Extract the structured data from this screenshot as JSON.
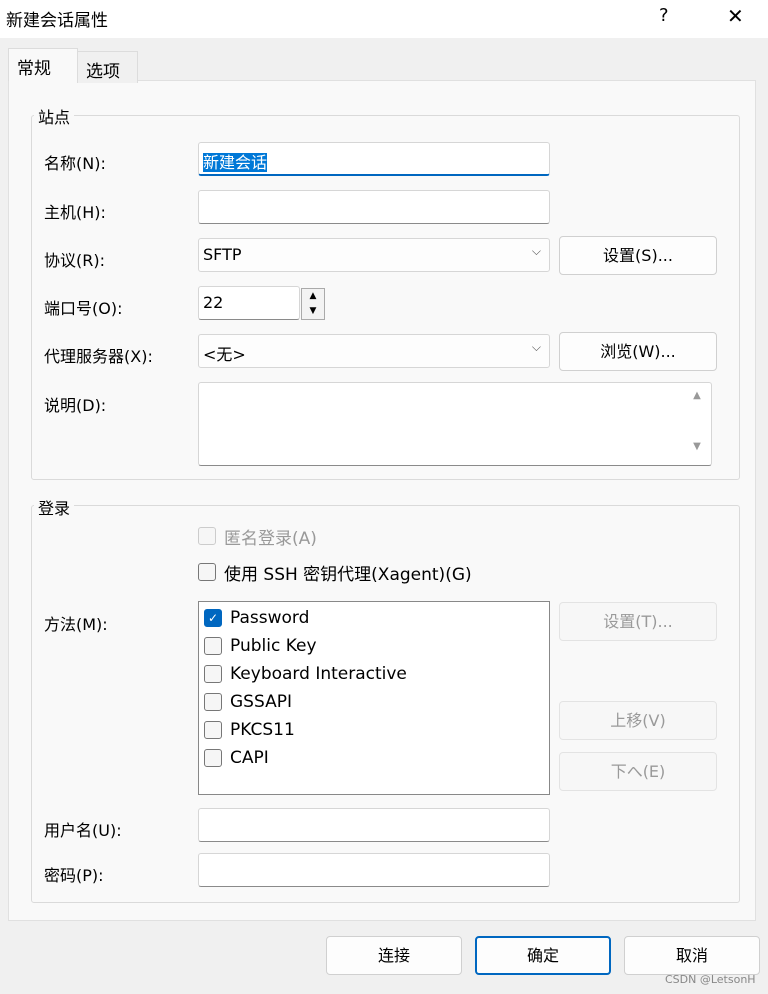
{
  "window": {
    "title": "新建会话属性",
    "help": "?",
    "close": "✕"
  },
  "tabs": [
    {
      "label": "常规",
      "active": true
    },
    {
      "label": "选项",
      "active": false
    }
  ],
  "site": {
    "legend": "站点",
    "name_label": "名称(N):",
    "name_value": "新建会话",
    "host_label": "主机(H):",
    "host_value": "",
    "protocol_label": "协议(R):",
    "protocol_value": "SFTP",
    "protocol_settings": "设置(S)...",
    "port_label": "端口号(O):",
    "port_value": "22",
    "proxy_label": "代理服务器(X):",
    "proxy_value": "<无>",
    "proxy_browse": "浏览(W)...",
    "desc_label": "说明(D):",
    "desc_value": ""
  },
  "login": {
    "legend": "登录",
    "anonymous": {
      "label": "匿名登录(A)",
      "checked": false,
      "disabled": true
    },
    "xagent": {
      "label": "使用 SSH 密钥代理(Xagent)(G)",
      "checked": false
    },
    "method_label": "方法(M):",
    "methods": [
      {
        "label": "Password",
        "checked": true
      },
      {
        "label": "Public Key",
        "checked": false
      },
      {
        "label": "Keyboard Interactive",
        "checked": false
      },
      {
        "label": "GSSAPI",
        "checked": false
      },
      {
        "label": "PKCS11",
        "checked": false
      },
      {
        "label": "CAPI",
        "checked": false
      }
    ],
    "settings": "设置(T)...",
    "up": "上移(V)",
    "down": "下へ(E)",
    "user_label": "用户名(U):",
    "user_value": "",
    "pass_label": "密码(P):",
    "pass_value": ""
  },
  "buttons": {
    "connect": "连接",
    "ok": "确定",
    "cancel": "取消"
  },
  "watermark": "CSDN @LetsonH",
  "colors": {
    "accent": "#0067c0"
  }
}
